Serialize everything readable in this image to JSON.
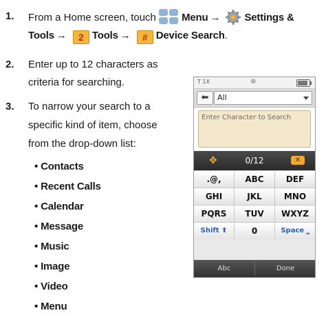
{
  "steps": [
    {
      "number": "1.",
      "text_from": "From a Home screen, touch",
      "menu_label": "Menu",
      "settings_label": "Settings &",
      "tools_line_lead": "Tools",
      "key_2": "2",
      "tools_label": "Tools",
      "key_hash": "#",
      "device_search_label": "Device Search",
      "period": "."
    },
    {
      "number": "2.",
      "lines": [
        "Enter up to 12 characters as",
        "criteria for searching."
      ]
    },
    {
      "number": "3.",
      "lines": [
        "To narrow your search to a",
        "specific kind of item, choose",
        "from the drop-down list:"
      ]
    }
  ],
  "arrow": "→",
  "bullet_char": "•",
  "categories": [
    "Contacts",
    "Recent Calls",
    "Calendar",
    "Message",
    "Music",
    "Image",
    "Video",
    "Menu"
  ],
  "phone": {
    "status_left": "T 1X",
    "status_mid": "⊕",
    "back_glyph": "⬅",
    "dropdown_value": "All",
    "search_placeholder": "Enter Character to Search",
    "cursor_glyph": "✥",
    "char_count": "0/12",
    "delete_glyph": "✕",
    "keys": [
      [
        ".@,",
        "ABC",
        "DEF"
      ],
      [
        "GHI",
        "JKL",
        "MNO"
      ],
      [
        "PQRS",
        "TUV",
        "WXYZ"
      ],
      [
        "Shift ⬆",
        "0",
        "Space ⎵"
      ]
    ],
    "bottom_left": "Abc",
    "bottom_right": "Done"
  },
  "colors": {
    "menu_icon": "#8fb3d9",
    "key_box": "#f5b63c",
    "search_box": "#f3e8cc",
    "accent_orange": "#f2a92b"
  }
}
